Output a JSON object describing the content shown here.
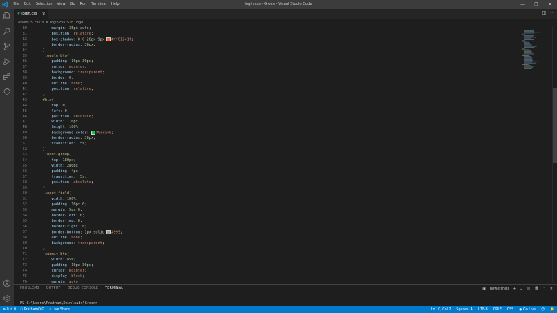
{
  "window": {
    "title": "login.css - Green - Visual Studio Code"
  },
  "menu": [
    "File",
    "Edit",
    "Selection",
    "View",
    "Go",
    "Run",
    "Terminal",
    "Help"
  ],
  "window_controls": {
    "minimize": "—",
    "restore": "❐",
    "close": "✕"
  },
  "tab": {
    "name": "login.css"
  },
  "breadcrumb": {
    "root": "assets",
    "sep1": ">",
    "folder": "css",
    "sep2": ">",
    "file": "login.css",
    "sep3": ">",
    "symbol": ".logo"
  },
  "code_lines": [
    {
      "n": "30",
      "indent": "        ",
      "prop": "margin",
      "val": "35px auto"
    },
    {
      "n": "31",
      "indent": "        ",
      "prop": "position",
      "val": "relative"
    },
    {
      "n": "32",
      "indent": "        ",
      "prop": "box-shadow",
      "val": "0 0 20px 9px",
      "swatch": "#ff61241f",
      "swatch_color": "#ff6124"
    },
    {
      "n": "33",
      "indent": "        ",
      "prop": "border-radius",
      "val": "30px"
    },
    {
      "n": "34",
      "indent": "    ",
      "close": "}"
    },
    {
      "n": "35",
      "indent": "    ",
      "sel": ".toggle-btn{"
    },
    {
      "n": "36",
      "indent": "        ",
      "prop": "padding",
      "val": "10px 30px"
    },
    {
      "n": "37",
      "indent": "        ",
      "prop": "cursor",
      "val": "pointer"
    },
    {
      "n": "38",
      "indent": "        ",
      "prop": "background",
      "val": "transparent"
    },
    {
      "n": "39",
      "indent": "        ",
      "prop": "border",
      "val": "0"
    },
    {
      "n": "40",
      "indent": "        ",
      "prop": "outline",
      "val": "none"
    },
    {
      "n": "41",
      "indent": "        ",
      "prop": "position",
      "val": "relative"
    },
    {
      "n": "42",
      "indent": "    ",
      "close": "}"
    },
    {
      "n": "43",
      "indent": "    ",
      "sel": "#btn{"
    },
    {
      "n": "44",
      "indent": "        ",
      "prop": "top",
      "val": "0"
    },
    {
      "n": "45",
      "indent": "        ",
      "prop": "left",
      "val": "0"
    },
    {
      "n": "46",
      "indent": "        ",
      "prop": "position",
      "val": "absolute"
    },
    {
      "n": "47",
      "indent": "        ",
      "prop": "width",
      "val": "110px"
    },
    {
      "n": "48",
      "indent": "        ",
      "prop": "height",
      "val": "100%"
    },
    {
      "n": "49",
      "indent": "        ",
      "prop": "background-color",
      "val": "",
      "swatch": "#0eca40",
      "swatch_color": "#0eca40"
    },
    {
      "n": "50",
      "indent": "        ",
      "prop": "border-radius",
      "val": "30px"
    },
    {
      "n": "51",
      "indent": "        ",
      "prop": "transition",
      "val": ".5s"
    },
    {
      "n": "52",
      "indent": "    ",
      "close": "}"
    },
    {
      "n": "53",
      "indent": "    ",
      "sel": ".input-group{"
    },
    {
      "n": "54",
      "indent": "        ",
      "prop": "top",
      "val": "180px"
    },
    {
      "n": "55",
      "indent": "        ",
      "prop": "width",
      "val": "280px"
    },
    {
      "n": "56",
      "indent": "        ",
      "prop": "padding",
      "val": "4px"
    },
    {
      "n": "57",
      "indent": "        ",
      "prop": "transition",
      "val": ".5s"
    },
    {
      "n": "58",
      "indent": "        ",
      "prop": "position",
      "val": "absolute"
    },
    {
      "n": "59",
      "indent": "    ",
      "close": "}"
    },
    {
      "n": "60",
      "indent": "    ",
      "sel": ".input-field{"
    },
    {
      "n": "61",
      "indent": "        ",
      "prop": "width",
      "val": "100%"
    },
    {
      "n": "62",
      "indent": "        ",
      "prop": "padding",
      "val": "10px 0"
    },
    {
      "n": "63",
      "indent": "        ",
      "prop": "margin",
      "val": "5px 0"
    },
    {
      "n": "64",
      "indent": "        ",
      "prop": "border-left",
      "val": "0"
    },
    {
      "n": "65",
      "indent": "        ",
      "prop": "border-top",
      "val": "0"
    },
    {
      "n": "66",
      "indent": "        ",
      "prop": "border-right",
      "val": "0"
    },
    {
      "n": "67",
      "indent": "        ",
      "prop": "border-bottom",
      "val": "1px solid",
      "swatch": "#999",
      "swatch_color": "#999999"
    },
    {
      "n": "68",
      "indent": "        ",
      "prop": "outline",
      "val": "none"
    },
    {
      "n": "69",
      "indent": "        ",
      "prop": "background",
      "val": "transparent"
    },
    {
      "n": "70",
      "indent": "    ",
      "close": "}"
    },
    {
      "n": "71",
      "indent": "    ",
      "sel": ".submit-btn{"
    },
    {
      "n": "72",
      "indent": "        ",
      "prop": "width",
      "val": "85%"
    },
    {
      "n": "73",
      "indent": "        ",
      "prop": "padding",
      "val": "10px 30px"
    },
    {
      "n": "74",
      "indent": "        ",
      "prop": "cursor",
      "val": "pointer"
    },
    {
      "n": "75",
      "indent": "        ",
      "prop": "display",
      "val": "block"
    },
    {
      "n": "76",
      "indent": "        ",
      "prop": "margin",
      "val": "auto"
    }
  ],
  "panel": {
    "tabs": [
      "PROBLEMS",
      "OUTPUT",
      "DEBUG CONSOLE",
      "TERMINAL"
    ],
    "active_tab": "TERMINAL",
    "shell": "powershell",
    "prompt": "PS C:\\Users\\Pratham\\Downloads\\Green>"
  },
  "statusbar": {
    "errors": "0",
    "warnings": "0",
    "account": "PrathamOIG",
    "live_share": "Live Share",
    "cursor": "Ln 10, Col 2",
    "spaces": "Spaces: 4",
    "encoding": "UTF-8",
    "eol": "CRLF",
    "language": "CSS",
    "go_live": "Go Live"
  },
  "colors": {
    "statusbar": "#007acc",
    "editor_bg": "#1e1e1e",
    "activity_bar": "#333333",
    "title_bar": "#3c3c3c"
  }
}
